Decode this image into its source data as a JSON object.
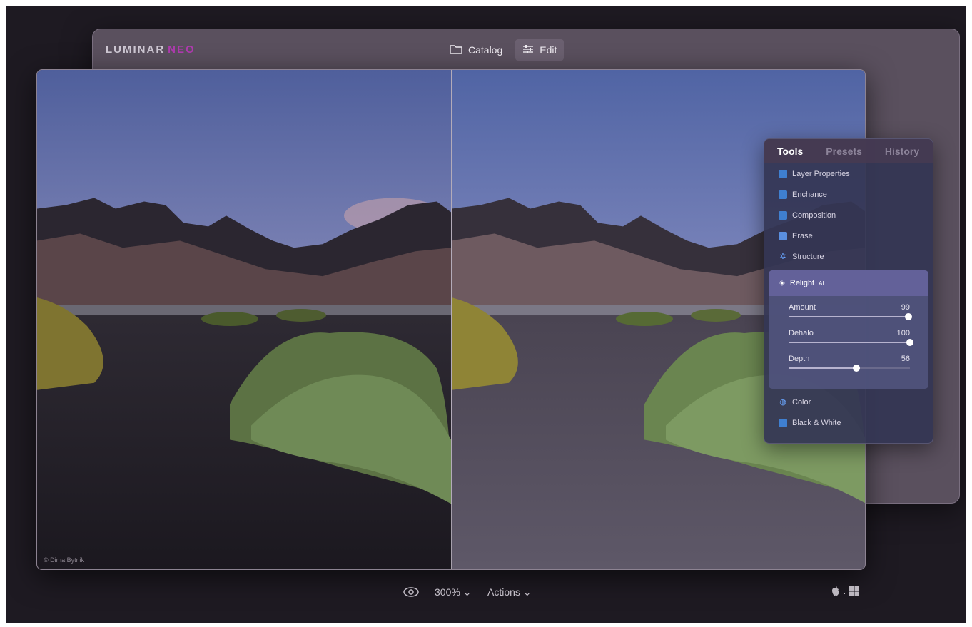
{
  "app": {
    "logo": "LUMINAR",
    "logo_suffix": "NEO"
  },
  "topnav": {
    "catalog_label": "Catalog",
    "edit_label": "Edit"
  },
  "panel": {
    "tabs": [
      {
        "label": "Tools",
        "active": true
      },
      {
        "label": "Presets",
        "active": false
      },
      {
        "label": "History",
        "active": false
      }
    ],
    "tools_top": [
      {
        "label": "Layer Properties",
        "icon": "layers-icon",
        "color": "#4a8fd8"
      },
      {
        "label": "Enchance",
        "icon": "enhance-icon",
        "color": "#4a8fd8"
      },
      {
        "label": "Composition",
        "icon": "crop-icon",
        "color": "#4a8fd8"
      },
      {
        "label": "Erase",
        "icon": "eraser-icon",
        "color": "#4a8fd8"
      },
      {
        "label": "Structure",
        "icon": "structure-icon",
        "color": "#4a8fd8"
      }
    ],
    "relight": {
      "label": "Relight",
      "badge": "AI",
      "icon": "sun-icon",
      "sliders": [
        {
          "label": "Amount",
          "value": 99,
          "min": 0,
          "max": 100
        },
        {
          "label": "Dehalo",
          "value": 100,
          "min": 0,
          "max": 100
        },
        {
          "label": "Depth",
          "value": 56,
          "min": 0,
          "max": 100
        }
      ]
    },
    "tools_bottom": [
      {
        "label": "Color",
        "icon": "color-icon",
        "color": "#4a8fd8"
      },
      {
        "label": "Black & White",
        "icon": "bw-icon",
        "color": "#4a8fd8"
      }
    ]
  },
  "photo": {
    "credit": "© Dima Bytnik"
  },
  "bottombar": {
    "zoom": "300%",
    "actions": "Actions"
  },
  "colors": {
    "accent": "#b03bb0",
    "background": "#1e1a22"
  }
}
